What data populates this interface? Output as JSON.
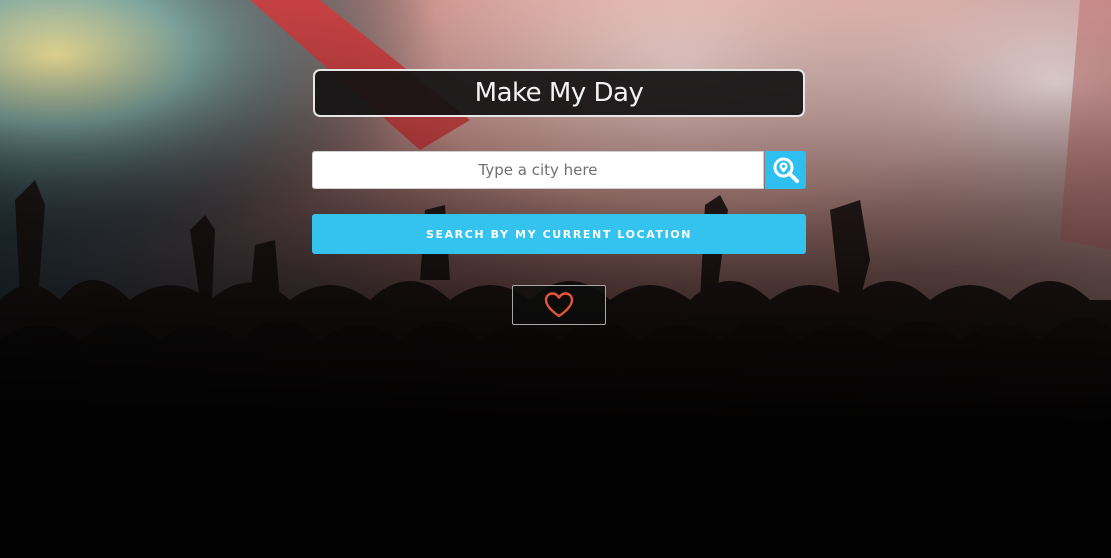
{
  "app": {
    "title": "Make My Day"
  },
  "search": {
    "placeholder": "Type a city here",
    "value": "",
    "button_icon": "search-location-icon"
  },
  "location_button": {
    "label": "SEARCH BY MY CURRENT LOCATION"
  },
  "favorites_button": {
    "icon": "heart-icon"
  },
  "colors": {
    "accent": "#34c2ef",
    "heart": "#e0553c",
    "title_bg": "#141214"
  }
}
